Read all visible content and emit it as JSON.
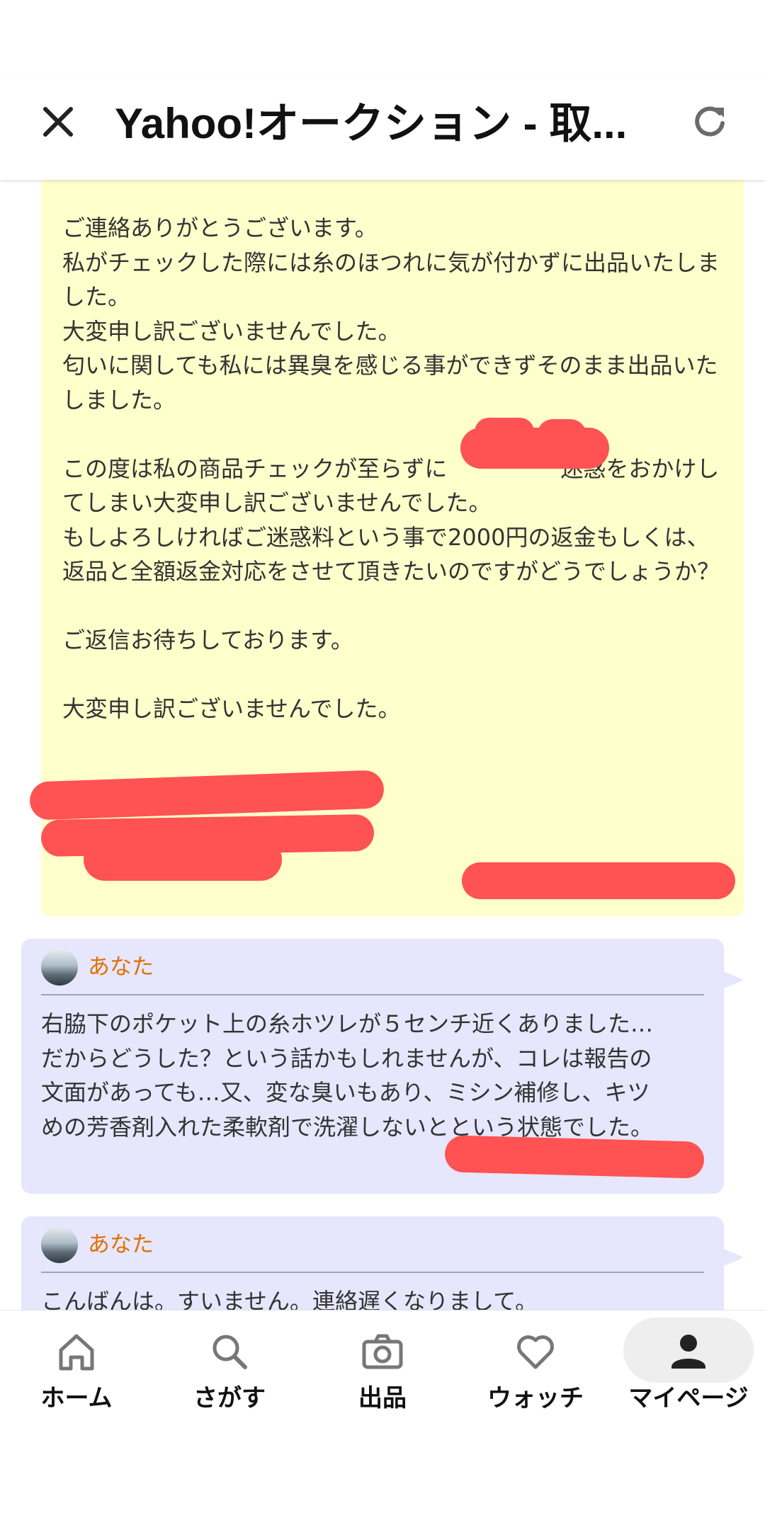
{
  "header": {
    "title": "Yahoo!オークション - 取...",
    "close_icon": "close-icon",
    "reload_icon": "reload-icon"
  },
  "seller_message": {
    "text": "ご連絡ありがとうございます。\n私がチェックした際には糸のほつれに気が付かずに出品いたしました。\n大変申し訳ございませんでした。\n匂いに関しても私には異臭を感じる事ができずそのまま出品いたしました。\n\nこの度は私の商品チェックが至らずに　　　　　迷惑をおかけしてしまい大変申し訳ございませんでした。\nもしよろしければご迷惑料という事で2000円の返金もしくは、返品と全額返金対応をさせて頂きたいのですがどうでしょうか？\n\nご返信お待ちしております。\n\n大変申し訳ございませんでした。"
  },
  "messages": [
    {
      "sender": "あなた",
      "text": "右脇下のポケット上の糸ホツレが５センチ近くありました…\nだからどうした？という話かもしれませんが、コレは報告の\n文面があっても…又、変な臭いもあり、ミシン補修し、キツ\nめの芳香剤入れた柔軟剤で洗濯しないとという状態でした。"
    },
    {
      "sender": "あなた",
      "text": "こんばんは。すいません。連絡遅くなりまして。"
    }
  ],
  "nav": {
    "items": [
      {
        "label": "ホーム",
        "icon": "home-icon"
      },
      {
        "label": "さがす",
        "icon": "search-icon"
      },
      {
        "label": "出品",
        "icon": "camera-icon"
      },
      {
        "label": "ウォッチ",
        "icon": "heart-icon"
      },
      {
        "label": "マイページ",
        "icon": "person-icon"
      }
    ],
    "active": "マイページ"
  },
  "colors": {
    "seller_bg": "#ffffcc",
    "my_bg": "#e6e6fc",
    "sender_name": "#e07000",
    "redaction": "#ff5252"
  }
}
